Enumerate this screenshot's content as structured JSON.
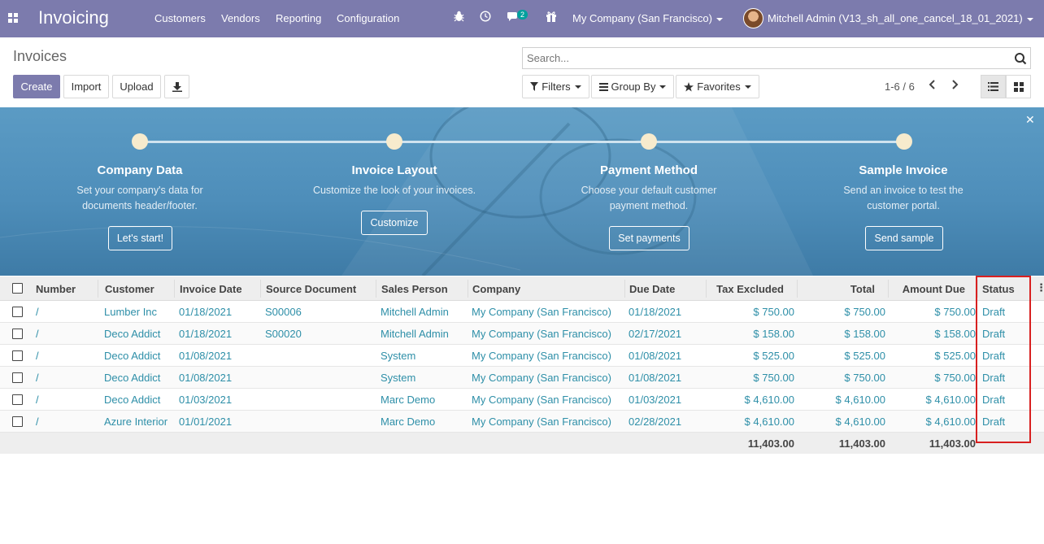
{
  "navbar": {
    "app_title": "Invoicing",
    "menu": [
      "Customers",
      "Vendors",
      "Reporting",
      "Configuration"
    ],
    "chat_badge": "2",
    "company": "My Company (San Francisco)",
    "user": "Mitchell Admin (V13_sh_all_one_cancel_18_01_2021)",
    "color": "#7c7bad"
  },
  "control": {
    "title": "Invoices",
    "create_label": "Create",
    "import_label": "Import",
    "upload_label": "Upload",
    "search_placeholder": "Search...",
    "filters_label": "Filters",
    "groupby_label": "Group By",
    "favorites_label": "Favorites",
    "pager": "1-6 / 6"
  },
  "banner": {
    "steps": [
      {
        "title": "Company Data",
        "desc1": "Set your company's data for",
        "desc2": "documents header/footer.",
        "button": "Let's start!"
      },
      {
        "title": "Invoice Layout",
        "desc1": "Customize the look of your invoices.",
        "desc2": "",
        "button": "Customize"
      },
      {
        "title": "Payment Method",
        "desc1": "Choose your default customer",
        "desc2": "payment method.",
        "button": "Set payments"
      },
      {
        "title": "Sample Invoice",
        "desc1": "Send an invoice to test the",
        "desc2": "customer portal.",
        "button": "Send sample"
      }
    ]
  },
  "table": {
    "headers": {
      "number": "Number",
      "customer": "Customer",
      "invoice_date": "Invoice Date",
      "source": "Source Document",
      "salesperson": "Sales Person",
      "company": "Company",
      "due_date": "Due Date",
      "tax_excluded": "Tax Excluded",
      "total": "Total",
      "amount_due": "Amount Due",
      "status": "Status"
    },
    "rows": [
      {
        "number": "/",
        "customer": "Lumber Inc",
        "invoice_date": "01/18/2021",
        "source": "S00006",
        "salesperson": "Mitchell Admin",
        "company": "My Company (San Francisco)",
        "due_date": "01/18/2021",
        "tax_excluded": "$ 750.00",
        "total": "$ 750.00",
        "amount_due": "$ 750.00",
        "status": "Draft"
      },
      {
        "number": "/",
        "customer": "Deco Addict",
        "invoice_date": "01/18/2021",
        "source": "S00020",
        "salesperson": "Mitchell Admin",
        "company": "My Company (San Francisco)",
        "due_date": "02/17/2021",
        "tax_excluded": "$ 158.00",
        "total": "$ 158.00",
        "amount_due": "$ 158.00",
        "status": "Draft"
      },
      {
        "number": "/",
        "customer": "Deco Addict",
        "invoice_date": "01/08/2021",
        "source": "",
        "salesperson": "System",
        "company": "My Company (San Francisco)",
        "due_date": "01/08/2021",
        "tax_excluded": "$ 525.00",
        "total": "$ 525.00",
        "amount_due": "$ 525.00",
        "status": "Draft"
      },
      {
        "number": "/",
        "customer": "Deco Addict",
        "invoice_date": "01/08/2021",
        "source": "",
        "salesperson": "System",
        "company": "My Company (San Francisco)",
        "due_date": "01/08/2021",
        "tax_excluded": "$ 750.00",
        "total": "$ 750.00",
        "amount_due": "$ 750.00",
        "status": "Draft"
      },
      {
        "number": "/",
        "customer": "Deco Addict",
        "invoice_date": "01/03/2021",
        "source": "",
        "salesperson": "Marc Demo",
        "company": "My Company (San Francisco)",
        "due_date": "01/03/2021",
        "tax_excluded": "$ 4,610.00",
        "total": "$ 4,610.00",
        "amount_due": "$ 4,610.00",
        "status": "Draft"
      },
      {
        "number": "/",
        "customer": "Azure Interior",
        "invoice_date": "01/01/2021",
        "source": "",
        "salesperson": "Marc Demo",
        "company": "My Company (San Francisco)",
        "due_date": "02/28/2021",
        "tax_excluded": "$ 4,610.00",
        "total": "$ 4,610.00",
        "amount_due": "$ 4,610.00",
        "status": "Draft"
      }
    ],
    "totals": {
      "tax_excluded": "11,403.00",
      "total": "11,403.00",
      "amount_due": "11,403.00"
    },
    "link_color": "#2e8fa8"
  }
}
